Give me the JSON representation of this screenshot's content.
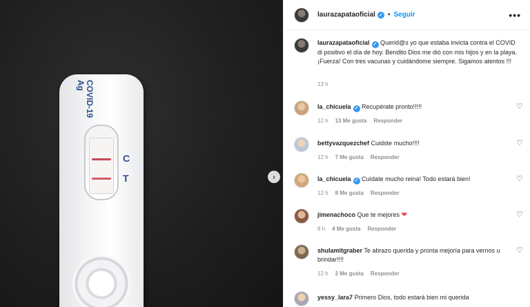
{
  "post": {
    "photo": {
      "test_brand_line1": "COVID-19",
      "test_brand_line2": "Ag",
      "control_mark": "C",
      "test_mark": "T",
      "next_icon": "chevron-right-icon"
    },
    "author": {
      "username": "laurazapataoficial",
      "verified_icon": "verified-badge-icon",
      "follow_label": "Seguir",
      "separator": "•",
      "more_icon": "•••"
    },
    "caption": {
      "username": "laurazapataoficial",
      "text": "Querid@s yo que estaba invicta contra el COVID di positivo el día de hoy. Bendito Dios me dió con mis hijos y en la playa. ¡Fuerza! Con tres vacunas y cuidándome siempre. Sigamos atentos !!!",
      "time": "13 h"
    },
    "comments": [
      {
        "username": "la_chicuela",
        "verified": true,
        "text": "Recupérate pronto!!!!!",
        "time": "12 h",
        "likes": "13 Me gusta",
        "reply": "Responder"
      },
      {
        "username": "bettyvazquezchef",
        "verified": false,
        "text": "Cuidste mucho!!!!",
        "time": "12 h",
        "likes": "7 Me gusta",
        "reply": "Responder"
      },
      {
        "username": "la_chicuela",
        "verified": true,
        "text": "Cuídate mucho reina! Todo estará bien!",
        "time": "12 h",
        "likes": "8 Me gusta",
        "reply": "Responder"
      },
      {
        "username": "jimenachoco",
        "verified": false,
        "text": "Que te mejores",
        "emoji": "❤",
        "time": "9 h",
        "likes": "4 Me gusta",
        "reply": "Responder"
      },
      {
        "username": "shulamitgraber",
        "verified": false,
        "text": "Te abrazo querida y pronta mejoría para vernos u brindar!!!!",
        "time": "12 h",
        "likes": "2 Me gusta",
        "reply": "Responder"
      },
      {
        "username": "yessy_lara7",
        "verified": false,
        "text": "Primero Dios, todo estará bien mi querida",
        "time": "",
        "likes": "",
        "reply": ""
      }
    ],
    "like_icon": "♡",
    "verified_mark": "✓"
  }
}
